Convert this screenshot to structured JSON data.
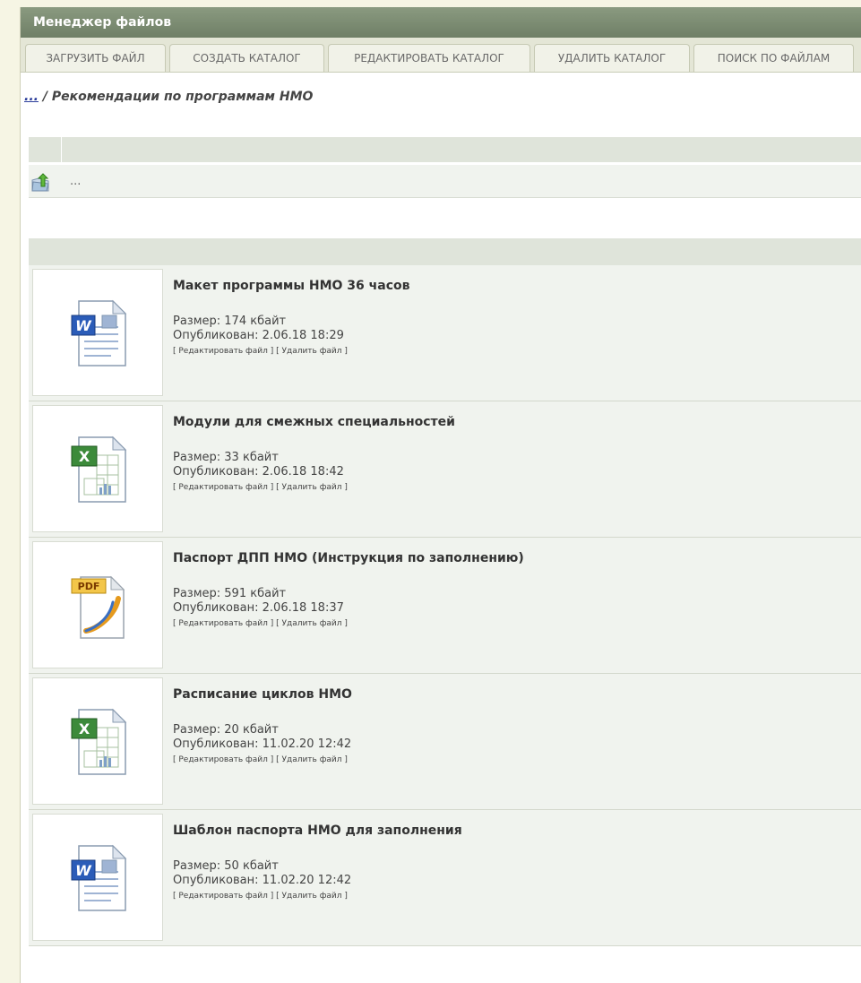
{
  "window": {
    "title": "Менеджер файлов"
  },
  "tabs": [
    {
      "label": "ЗАГРУЗИТЬ ФАЙЛ"
    },
    {
      "label": "СОЗДАТЬ КАТАЛОГ"
    },
    {
      "label": "РЕДАКТИРОВАТЬ КАТАЛОГ"
    },
    {
      "label": "УДАЛИТЬ КАТАЛОГ"
    },
    {
      "label": "ПОИСК ПО ФАЙЛАМ"
    }
  ],
  "breadcrumb": {
    "up_link": "...",
    "separator": " / ",
    "current": "Рекомендации по программам НМО"
  },
  "directory": {
    "up_label": "...",
    "up_icon": "folder-up-icon"
  },
  "files": [
    {
      "name": "Макет программы НМО 36 часов",
      "size": "Размер: 174 кбайт",
      "published": "Опубликован: 2.06.18 18:29",
      "edit": "[ Редактировать файл ]",
      "delete": "[ Удалить файл ]",
      "icon": "word-document-icon"
    },
    {
      "name": "Модули для смежных специальностей",
      "size": "Размер: 33 кбайт",
      "published": "Опубликован: 2.06.18 18:42",
      "edit": "[ Редактировать файл ]",
      "delete": "[ Удалить файл ]",
      "icon": "excel-document-icon"
    },
    {
      "name": "Паспорт ДПП НМО (Инструкция по заполнению)",
      "size": "Размер: 591 кбайт",
      "published": "Опубликован: 2.06.18 18:37",
      "edit": "[ Редактировать файл ]",
      "delete": "[ Удалить файл ]",
      "icon": "pdf-document-icon",
      "icon_text": "PDF"
    },
    {
      "name": "Расписание циклов НМО",
      "size": "Размер: 20 кбайт",
      "published": "Опубликован: 11.02.20 12:42",
      "edit": "[ Редактировать файл ]",
      "delete": "[ Удалить файл ]",
      "icon": "excel-document-icon"
    },
    {
      "name": "Шаблон паспорта НМО для заполнения",
      "size": "Размер: 50 кбайт",
      "published": "Опубликован: 11.02.20 12:42",
      "edit": "[ Редактировать файл ]",
      "delete": "[ Удалить файл ]",
      "icon": "word-document-icon"
    }
  ],
  "colors": {
    "title_bar": "#7a8a70",
    "row_bg": "#f0f3ee",
    "header_bg": "#dfe4da",
    "link": "#2a3c9a"
  }
}
